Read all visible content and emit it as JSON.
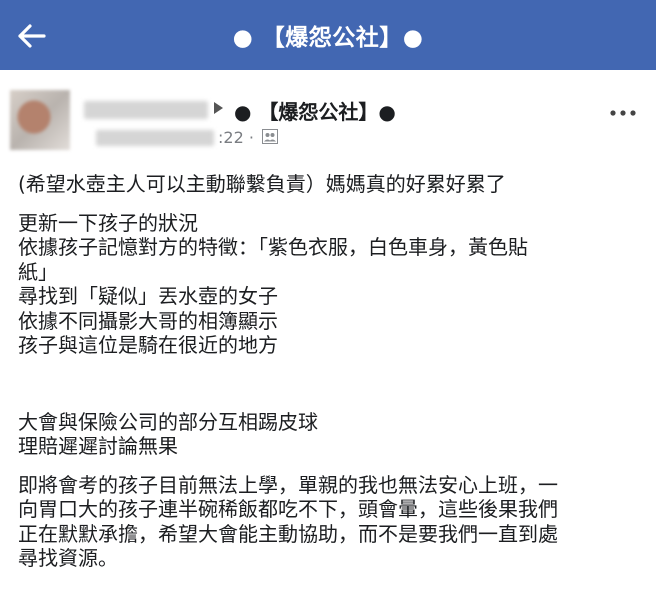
{
  "topbar": {
    "back_icon": "arrow-left-icon",
    "title": "● 【爆怨公社】● ",
    "color": "#4267b2"
  },
  "post_header": {
    "page_name": "● 【爆怨公社】●",
    "timestamp": ":22 ·",
    "privacy_icon": "friends-icon",
    "more_icon": "more-horizontal-icon"
  },
  "post_body": {
    "paragraph_1": "(希望水壺主人可以主動聯繫負責）媽媽真的好累好累了",
    "paragraph_2_lines": [
      "更新一下孩子的狀況",
      "依據孩子記憶對方的特徵：「紫色衣服，白色車身，黃色貼",
      "紙」",
      "尋找到「疑似」丟水壺的女子",
      "依據不同攝影大哥的相簿顯示",
      "孩子與這位是騎在很近的地方"
    ],
    "paragraph_3_lines": [
      "大會與保險公司的部分互相踢皮球",
      "理賠遲遲討論無果"
    ],
    "paragraph_4_lines": [
      "即將會考的孩子目前無法上學，單親的我也無法安心上班，一",
      "向胃口大的孩子連半碗稀飯都吃不下，頭會暈，這些後果我們",
      "正在默默承擔，希望大會能主動協助，而不是要我們一直到處",
      "尋找資源。"
    ]
  }
}
